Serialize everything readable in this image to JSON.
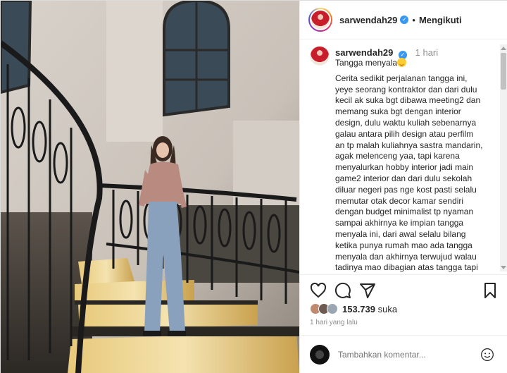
{
  "header": {
    "username": "sarwendah29",
    "separator": "•",
    "follow_label": "Mengikuti"
  },
  "caption": {
    "username": "sarwendah29",
    "time": "1 hari",
    "title": "Tangga menyala",
    "lines": [
      "Cerita sedikit perjalanan tangga ini,",
      "yeye seorang kontraktor dan dari dulu",
      "kecil ak suka bgt dibawa meeting2 dan",
      "memang suka bgt dengan interior",
      "design, dulu waktu kuliah sebenarnya",
      "galau antara pilih design atau perfilm",
      "an tp malah kuliahnya sastra mandarin,",
      "agak melenceng yaa, tapi karena",
      "menyalurkan hobby interior jadi main",
      "game2 interior dan dari dulu sekolah",
      "diluar negeri pas nge kost pasti selalu",
      "memutar otak decor kamar sendiri",
      "dengan budget minimalist tp nyaman",
      "sampai akhirnya ke impian tangga",
      "menyala ini, dari awal selalu bilang",
      "ketika punya rumah mao ada tangga",
      "menyala dan akhirnya terwujud walau",
      "tadinya mao dibagian atas tangga tapi"
    ]
  },
  "icons": {
    "like": "heart-icon",
    "comment": "comment-icon",
    "share": "share-icon",
    "save": "bookmark-icon",
    "emoji": "smile-icon"
  },
  "likes": {
    "count": "153.739",
    "suffix": "suka"
  },
  "posted": "1 hari yang lalu",
  "comment": {
    "placeholder": "Tambahkan komentar..."
  },
  "colors": {
    "verified": "#3897f0",
    "text": "#262626",
    "muted": "#8e8e8e"
  }
}
